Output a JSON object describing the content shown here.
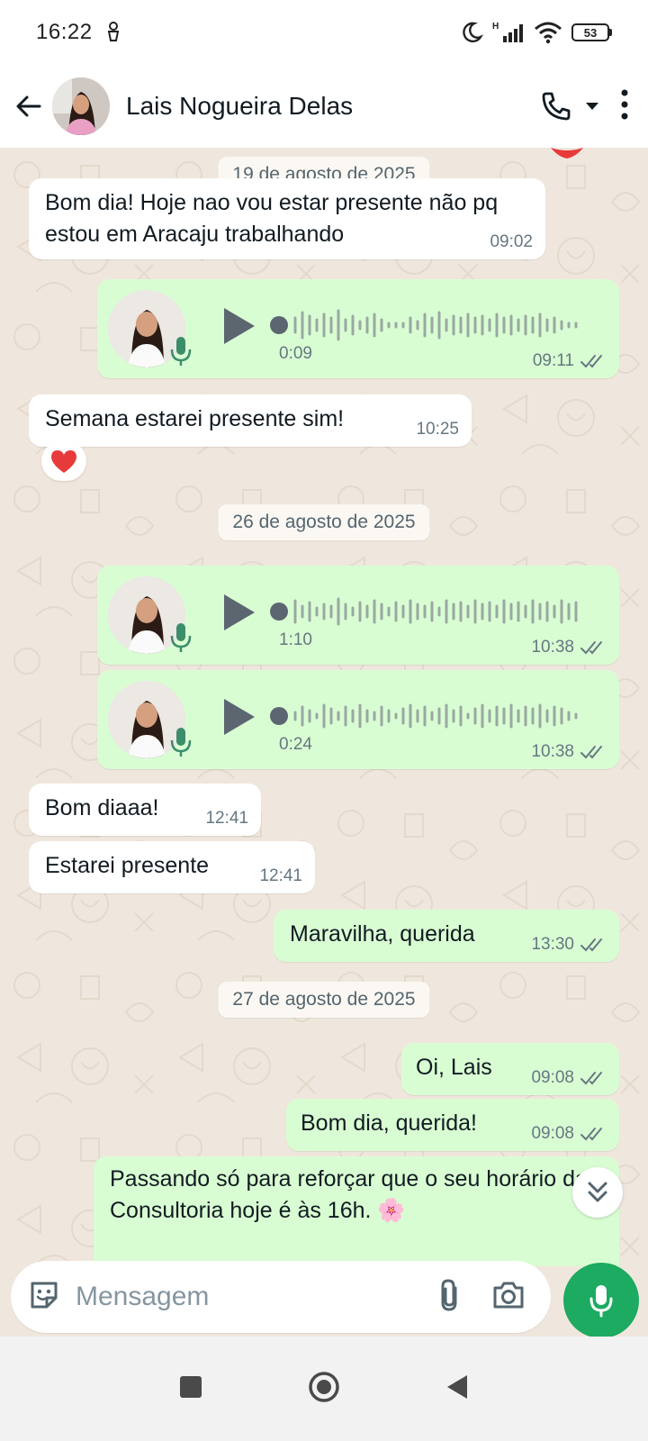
{
  "status_bar": {
    "time": "16:22",
    "battery": "53"
  },
  "header": {
    "contact_name": "Lais Nogueira Delas"
  },
  "messages": [
    {
      "date": "19 de agosto de 2025"
    },
    {
      "text": "Bom dia! Hoje nao vou estar presente não pq estou em Aracaju trabalhando",
      "time": "09:02"
    },
    {
      "duration": "0:09",
      "time": "09:11"
    },
    {
      "text": "Semana estarei presente sim!",
      "time": "10:25",
      "reaction": "❤️"
    },
    {
      "date": "26 de agosto de 2025"
    },
    {
      "duration": "1:10",
      "time": "10:38"
    },
    {
      "duration": "0:24",
      "time": "10:38"
    },
    {
      "text": "Bom diaaa!",
      "time": "12:41"
    },
    {
      "text": "Estarei presente",
      "time": "12:41"
    },
    {
      "text": "Maravilha, querida",
      "time": "13:30"
    },
    {
      "date": "27 de agosto de 2025"
    },
    {
      "text": "Oi, Lais",
      "time": "09:08"
    },
    {
      "text": "Bom dia, querida!",
      "time": "09:08"
    },
    {
      "text": "Passando só para reforçar que o seu horário da Consultoria hoje é às 16h. 🌸"
    }
  ],
  "input": {
    "placeholder": "Mensagem"
  },
  "icons": {
    "back": "arrow-left-icon",
    "call": "phone-icon",
    "menu": "more-vertical-icon",
    "emoji": "sticker-icon",
    "attach": "paperclip-icon",
    "camera": "camera-icon",
    "mic": "mic-icon",
    "scroll": "chevrons-down-icon"
  },
  "colors": {
    "incoming": "#ffffff",
    "outgoing": "#d9fdd3",
    "accent": "#1daa61",
    "wallpaper": "#efe7dd",
    "ticks": "#667781"
  }
}
